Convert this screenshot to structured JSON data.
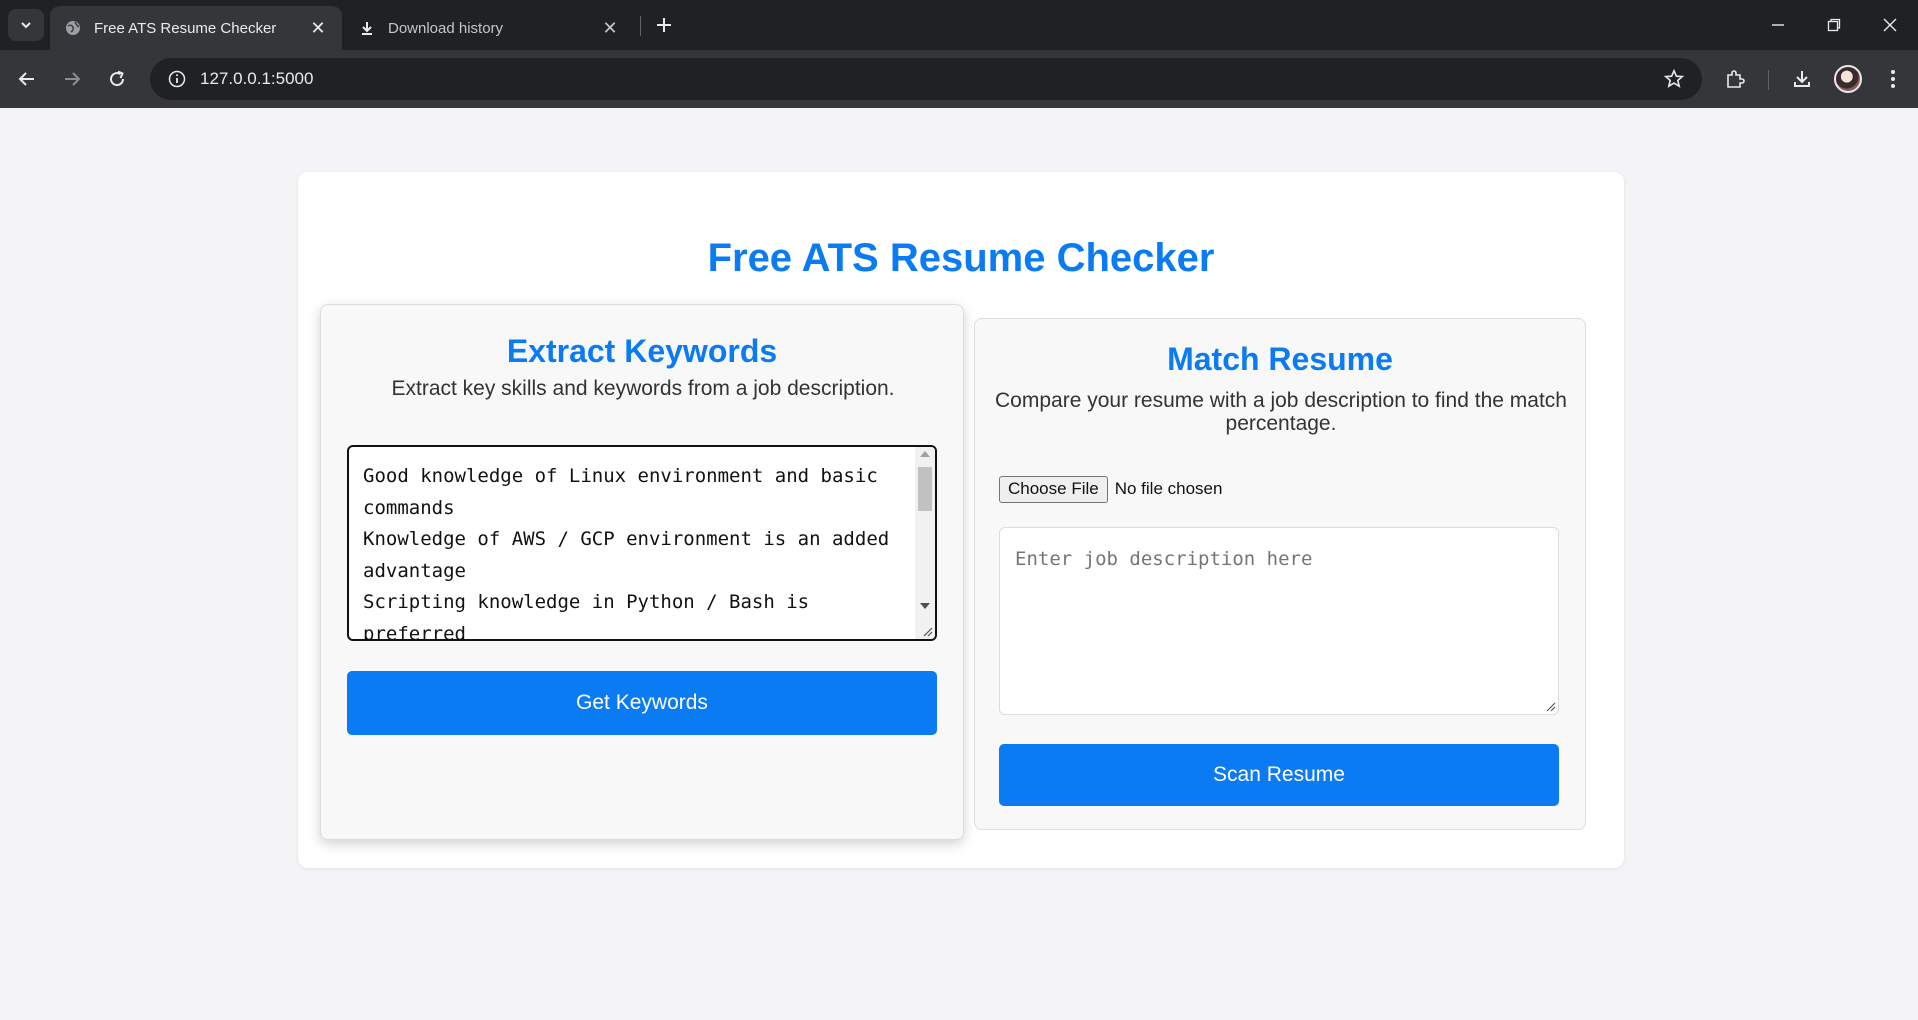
{
  "browser": {
    "tabs": [
      {
        "title": "Free ATS Resume Checker",
        "icon": "globe-icon",
        "active": true
      },
      {
        "title": "Download history",
        "icon": "download-icon",
        "active": false
      }
    ],
    "url": "127.0.0.1:5000"
  },
  "page": {
    "title": "Free ATS Resume Checker",
    "extract": {
      "heading": "Extract Keywords",
      "description": "Extract key skills and keywords from a job description.",
      "textarea_value": "Good knowledge of Linux environment and basic commands\nKnowledge of AWS / GCP environment is an added advantage\nScripting knowledge in Python / Bash is preferred",
      "button_label": "Get Keywords"
    },
    "match": {
      "heading": "Match Resume",
      "description": "Compare your resume with a job description to find the match percentage.",
      "file_button_label": "Choose File",
      "file_status": "No file chosen",
      "textarea_placeholder": "Enter job description here",
      "button_label": "Scan Resume"
    }
  },
  "colors": {
    "accent": "#0a7bf2",
    "chrome_dark": "#202124",
    "chrome_toolbar": "#35363a",
    "page_bg": "#f4f4f6"
  }
}
